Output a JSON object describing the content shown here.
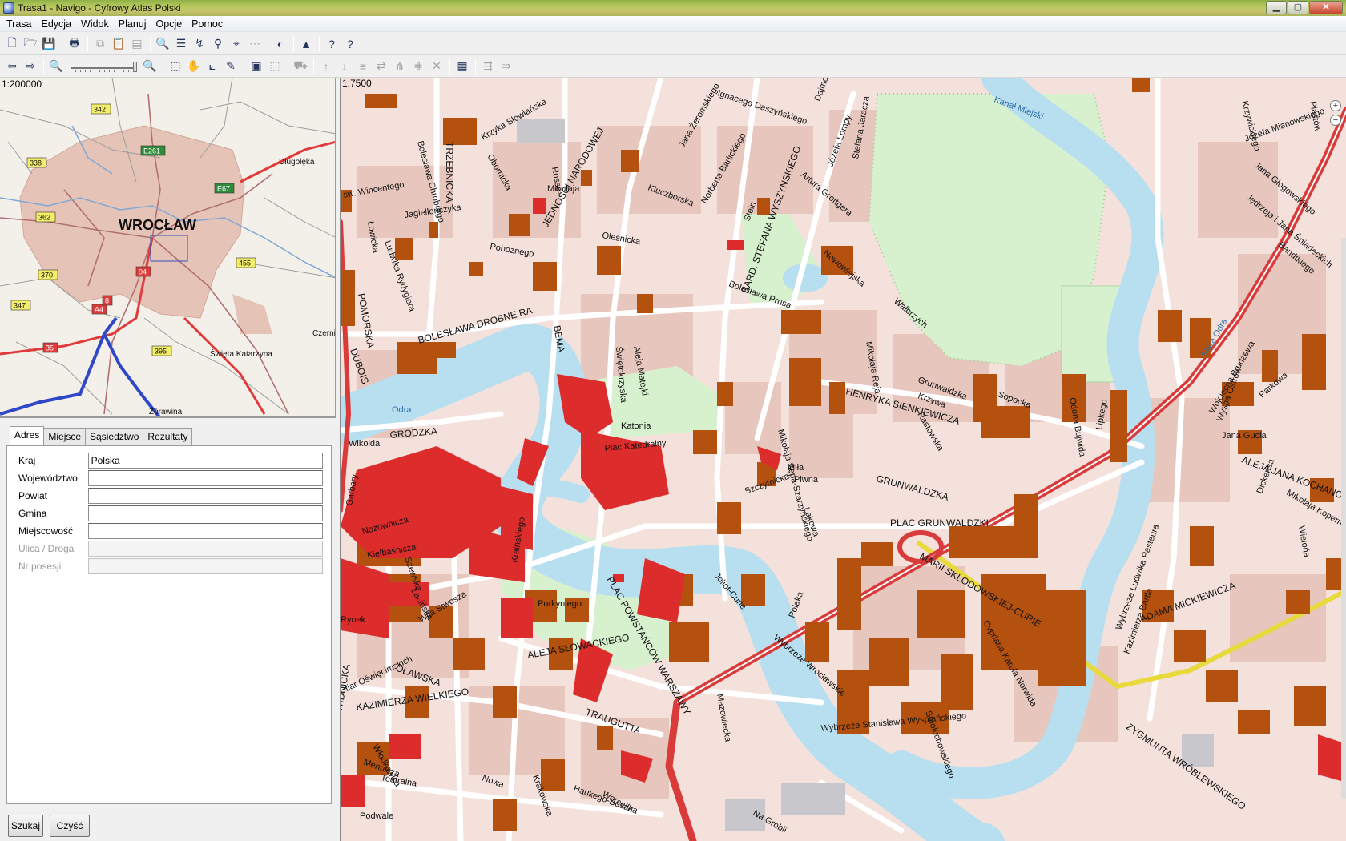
{
  "window": {
    "title": "Trasa1 - Navigo - Cyfrowy Atlas Polski",
    "app_icon": "globe-icon",
    "controls": [
      "minimize-icon",
      "maximize-icon",
      "close-icon"
    ]
  },
  "menu": [
    "Trasa",
    "Edycja",
    "Widok",
    "Planuj",
    "Opcje",
    "Pomoc"
  ],
  "toolbar1": [
    {
      "name": "new-file-icon",
      "glyph": "🗋",
      "enabled": true
    },
    {
      "name": "open-folder-icon",
      "glyph": "🗁",
      "enabled": true
    },
    {
      "name": "save-icon",
      "glyph": "💾",
      "enabled": true
    },
    {
      "name": "print-icon",
      "glyph": "🖶",
      "enabled": true
    },
    {
      "name": "copy-icon",
      "glyph": "⧉",
      "enabled": false
    },
    {
      "name": "paste-icon",
      "glyph": "📋",
      "enabled": false
    },
    {
      "name": "clipboard-icon",
      "glyph": "▤",
      "enabled": false
    },
    {
      "name": "find-icon",
      "glyph": "🔍",
      "enabled": true
    },
    {
      "name": "list-icon",
      "glyph": "☰",
      "enabled": true
    },
    {
      "name": "route-icon",
      "glyph": "↯",
      "enabled": true
    },
    {
      "name": "binoculars-icon",
      "glyph": "⚲",
      "enabled": true
    },
    {
      "name": "locate-icon",
      "glyph": "⌖",
      "enabled": true
    },
    {
      "name": "grid-icon",
      "glyph": "⋯",
      "enabled": false
    },
    {
      "name": "contrast-icon",
      "glyph": "◐",
      "enabled": true
    },
    {
      "name": "navigate-icon",
      "glyph": "▲",
      "enabled": true
    },
    {
      "name": "help-icon",
      "glyph": "?",
      "enabled": true
    },
    {
      "name": "context-help-icon",
      "glyph": "?",
      "enabled": true
    }
  ],
  "toolbar2": [
    {
      "name": "back-icon",
      "glyph": "⇦",
      "enabled": true
    },
    {
      "name": "forward-icon",
      "glyph": "⇨",
      "enabled": true
    },
    {
      "name": "zoom-out-icon",
      "glyph": "🔍",
      "enabled": true
    },
    {
      "name": "zoom-in-icon",
      "glyph": "🔍",
      "enabled": false
    },
    {
      "name": "select-icon",
      "glyph": "⬚",
      "enabled": true
    },
    {
      "name": "hand-pan-icon",
      "glyph": "✋",
      "enabled": true
    },
    {
      "name": "measure-icon",
      "glyph": "⟀",
      "enabled": true
    },
    {
      "name": "pen-icon",
      "glyph": "✎",
      "enabled": true
    },
    {
      "name": "map-view-icon",
      "glyph": "▣",
      "enabled": true
    },
    {
      "name": "select-area-icon",
      "glyph": "⬚",
      "enabled": false
    },
    {
      "name": "car-icon",
      "glyph": "⛟",
      "enabled": false
    },
    {
      "name": "move-up-icon",
      "glyph": "↑",
      "enabled": false
    },
    {
      "name": "move-down-icon",
      "glyph": "↓",
      "enabled": false
    },
    {
      "name": "align-icon",
      "glyph": "≡",
      "enabled": false
    },
    {
      "name": "route-swap-icon",
      "glyph": "⇄",
      "enabled": false
    },
    {
      "name": "route-split-icon",
      "glyph": "⋔",
      "enabled": false
    },
    {
      "name": "route-merge-icon",
      "glyph": "⋕",
      "enabled": false
    },
    {
      "name": "delete-icon",
      "glyph": "✕",
      "enabled": false
    },
    {
      "name": "itinerary-icon",
      "glyph": "▦",
      "enabled": true
    },
    {
      "name": "route-calc-icon",
      "glyph": "⇶",
      "enabled": false
    },
    {
      "name": "route-export-icon",
      "glyph": "⇛",
      "enabled": false
    }
  ],
  "overview": {
    "scale": "1:200000",
    "city": "WROCŁAW",
    "places": [
      "Długołęka",
      "Czernica",
      "Święta Katarzyna",
      "Żórawina"
    ],
    "road_badges": [
      "342",
      "338",
      "E261",
      "E67",
      "362",
      "455",
      "370",
      "347",
      "94",
      "A4",
      "8",
      "35",
      "395"
    ]
  },
  "tabs": [
    "Adres",
    "Miejsce",
    "Sąsiedztwo",
    "Rezultaty"
  ],
  "active_tab": "Adres",
  "form": [
    {
      "label": "Kraj",
      "value": "Polska",
      "enabled": true
    },
    {
      "label": "Województwo",
      "value": "",
      "enabled": true
    },
    {
      "label": "Powiat",
      "value": "",
      "enabled": true
    },
    {
      "label": "Gmina",
      "value": "",
      "enabled": true
    },
    {
      "label": "Miejscowość",
      "value": "",
      "enabled": true
    },
    {
      "label": "Ulica / Droga",
      "value": "",
      "enabled": false
    },
    {
      "label": "Nr posesji",
      "value": "",
      "enabled": false
    }
  ],
  "buttons": {
    "search": "Szukaj",
    "clear": "Czyść"
  },
  "map": {
    "scale": "1:7500",
    "zoom_in": "+",
    "zoom_out": "−",
    "colors": {
      "background": "#f4e1dc",
      "block": "#e7c8bf",
      "building": "#b5510f",
      "landmark": "#dd2c2c",
      "water": "#b8dff0",
      "park": "#d7f0ce",
      "road": "#ffffff",
      "main_road": "#d93a3a",
      "tram": "#eadd3a"
    },
    "streets": [
      "Ignacego Daszyńskiego",
      "Dajmora",
      "Kanał Miejski",
      "Krzywickiego",
      "Piastów",
      "Józefa Mianowskiego",
      "Jana Głogowskiego",
      "Jędrzeja i Jana Śniadeckich",
      "Bandtkiego",
      "TRZEBNICKA",
      "Bolesława Chrobrego",
      "św. Wincentego",
      "Jagiellończyka",
      "Łowicka",
      "Ludwika Rydygiera",
      "Obornicka",
      "Krzyka Słowiańska",
      "Rosso",
      "JEDNOŚCI NARODOWEJ",
      "Kluczborska",
      "Jana Żeromskiego",
      "Norberta Barlickiego",
      "Stein",
      "BARD. STEFANA WYSZYŃSKIEGO",
      "Józefa Lompy",
      "Stefana Jaracza",
      "Artura Grottgera",
      "Nowowiejska",
      "Oleśnicka",
      "Bolesława Prusa",
      "Pobożnego",
      "POMORSKA",
      "BOLESŁAWA DROBNE RA",
      "DUBOIS",
      "BEMA",
      "Świętokrzyska",
      "Aleja Matejki",
      "Mikołaja Reja",
      "Wałbrzych",
      "Grunwaldzka",
      "Krzywa",
      "HENRYKA SIENKIEWICZA",
      "Rastowska",
      "Odona Bujwida",
      "Lipkego",
      "Sopocka",
      "Odra",
      "Wikolda",
      "GRODZKA",
      "Katonia",
      "Plac Katedralny",
      "Mikołaja Sępa-Szarzyńskiego",
      "Miła",
      "Piwna",
      "Łąkowa",
      "Szczytnicka",
      "GRUNWALDZKA",
      "PLAC GRUNWALDZKI",
      "MARII SKŁODOWSKIEJ-CURIE",
      "Joliot-Curie",
      "Polaka",
      "Garbary",
      "Nożownicza",
      "Kiełbaśnicza",
      "Szewska",
      "Łacińska",
      "Wita Stwosza",
      "Rynek",
      "OŁAWSKA",
      "Ofiar Oświęcimskich",
      "KAZIMIERZA WIELKIEGO",
      "ŚWIDNICKA",
      "Włodkowica",
      "Mennicza",
      "Teatralna",
      "Nowa",
      "Podwale",
      "Kraińskiego",
      "Purkyniego",
      "PLAC POWSTAŃCÓW WARSZAWY",
      "ALEJA SŁOWACKIEGO",
      "TRAUGUTTA",
      "Krakowska",
      "Haukego-Bosaka",
      "Worcella",
      "Mazowiecka",
      "Na Grobli",
      "Wybrzeże Stanisława Wyspiańskiego",
      "Wybrzeże Wrocławskie",
      "Smoluchowskiego",
      "Cypriana Karola Norwida",
      "Wybrzeże Ludwika Pasteura",
      "Kazimierza Bartla",
      "ADAMA MICKIEWICZA",
      "ZYGMUNTA WRÓBLEWSKIEGO",
      "Wyspa Ostrów",
      "Stara Odra",
      "ALEJA JANA KOCHANOWSKIEGO",
      "Mikołaja Kopernika",
      "Wielońa",
      "Dickensa",
      "Parkowa",
      "Wojciecha Brudzewa",
      "Jana Gucia",
      "Mikołaja"
    ]
  }
}
